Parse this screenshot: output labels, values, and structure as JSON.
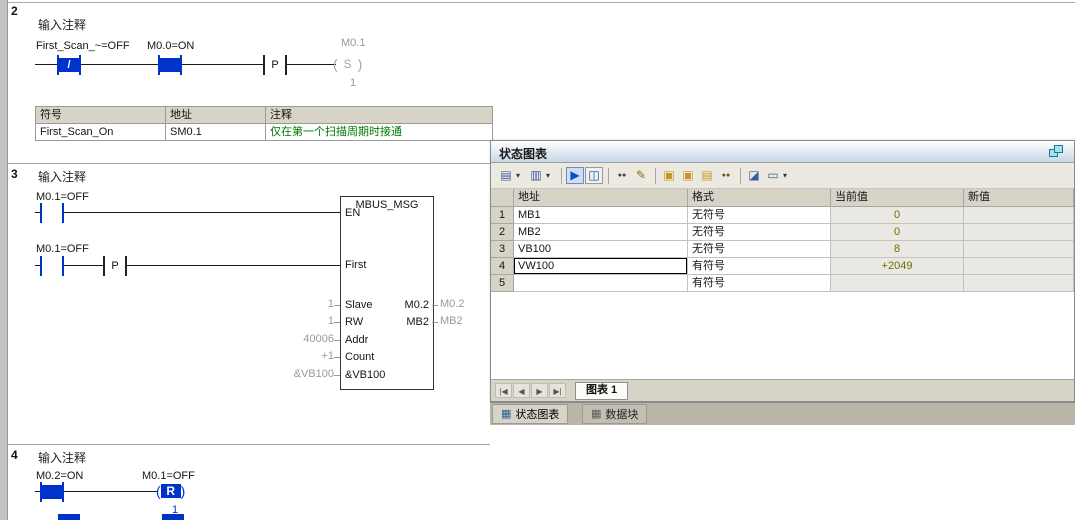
{
  "colors": {
    "powered_blue": "#0033cc",
    "comment_green": "#007a00",
    "current_value_olive": "#6e6e00",
    "header_gray": "#d7d3c7",
    "titlebar_gradient_end": "#c9d6e8"
  },
  "networks": {
    "n2": {
      "number": "2",
      "comment": "输入注释",
      "contact1_label": "First_Scan_~=OFF",
      "contact1_slash": "/",
      "contact2_label": "M0.0=ON",
      "edge_label": "P",
      "coil_operand": "M0.1",
      "coil_symbol": "S",
      "coil_param": "1",
      "symtable": {
        "headers": [
          "符号",
          "地址",
          "注释"
        ],
        "row": [
          "First_Scan_On",
          "SM0.1",
          "仅在第一个扫描周期时接通"
        ]
      }
    },
    "n3": {
      "number": "3",
      "comment": "输入注释",
      "contact1_label": "M0.1=OFF",
      "contact2_label": "M0.1=OFF",
      "edge_label": "P",
      "block": {
        "title": "MBUS_MSG",
        "inputs": [
          "EN",
          "First",
          "Slave",
          "RW",
          "Addr",
          "Count",
          "&VB100"
        ],
        "input_values": [
          "",
          "",
          "1",
          "1",
          "40006",
          "+1",
          "&VB100"
        ],
        "outputs": [
          "M0.2",
          "MB2"
        ],
        "output_values": [
          "M0.2",
          "MB2"
        ]
      }
    },
    "n4": {
      "number": "4",
      "comment": "输入注释",
      "contact1_label": "M0.2=ON",
      "coil_label": "M0.1=OFF",
      "coil_symbol": "R",
      "coil_param": "1"
    }
  },
  "status_chart": {
    "title": "状态图表",
    "dropdown_glyph": "▾",
    "tab_icon_glyph": "▦",
    "toolbar_icons": [
      {
        "name": "sort-chart-icon",
        "glyph": "▤"
      },
      {
        "name": "insert-column-icon",
        "glyph": "▥"
      },
      {
        "name": "chart-status-on-icon",
        "glyph": "▶"
      },
      {
        "name": "pause-trend-icon",
        "glyph": "◫"
      },
      {
        "name": "read-all-icon",
        "glyph": "●●"
      },
      {
        "name": "write-all-icon",
        "glyph": "✎"
      },
      {
        "name": "force-icon",
        "glyph": "▣"
      },
      {
        "name": "unforce-icon",
        "glyph": "▣"
      },
      {
        "name": "unforce-all-icon",
        "glyph": "▤"
      },
      {
        "name": "read-forced-icon",
        "glyph": "●●"
      },
      {
        "name": "trend-view-icon",
        "glyph": "◪"
      },
      {
        "name": "options-icon",
        "glyph": "▭"
      }
    ],
    "table": {
      "headers": [
        "地址",
        "格式",
        "当前值",
        "新值"
      ],
      "rows": [
        {
          "n": "1",
          "address": "MB1",
          "format": "无符号",
          "current": "0",
          "new_value": ""
        },
        {
          "n": "2",
          "address": "MB2",
          "format": "无符号",
          "current": "0",
          "new_value": ""
        },
        {
          "n": "3",
          "address": "VB100",
          "format": "无符号",
          "current": "8",
          "new_value": ""
        },
        {
          "n": "4",
          "address": "VW100",
          "format": "有符号",
          "current": "+2049",
          "new_value": ""
        },
        {
          "n": "5",
          "address": "",
          "format": "有符号",
          "current": "",
          "new_value": ""
        }
      ]
    },
    "nav_buttons": [
      "|◀",
      "◀",
      "▶",
      "▶|"
    ],
    "sheet_tab": "图表 1",
    "bottom_tabs": [
      "状态图表",
      "数据块"
    ]
  }
}
